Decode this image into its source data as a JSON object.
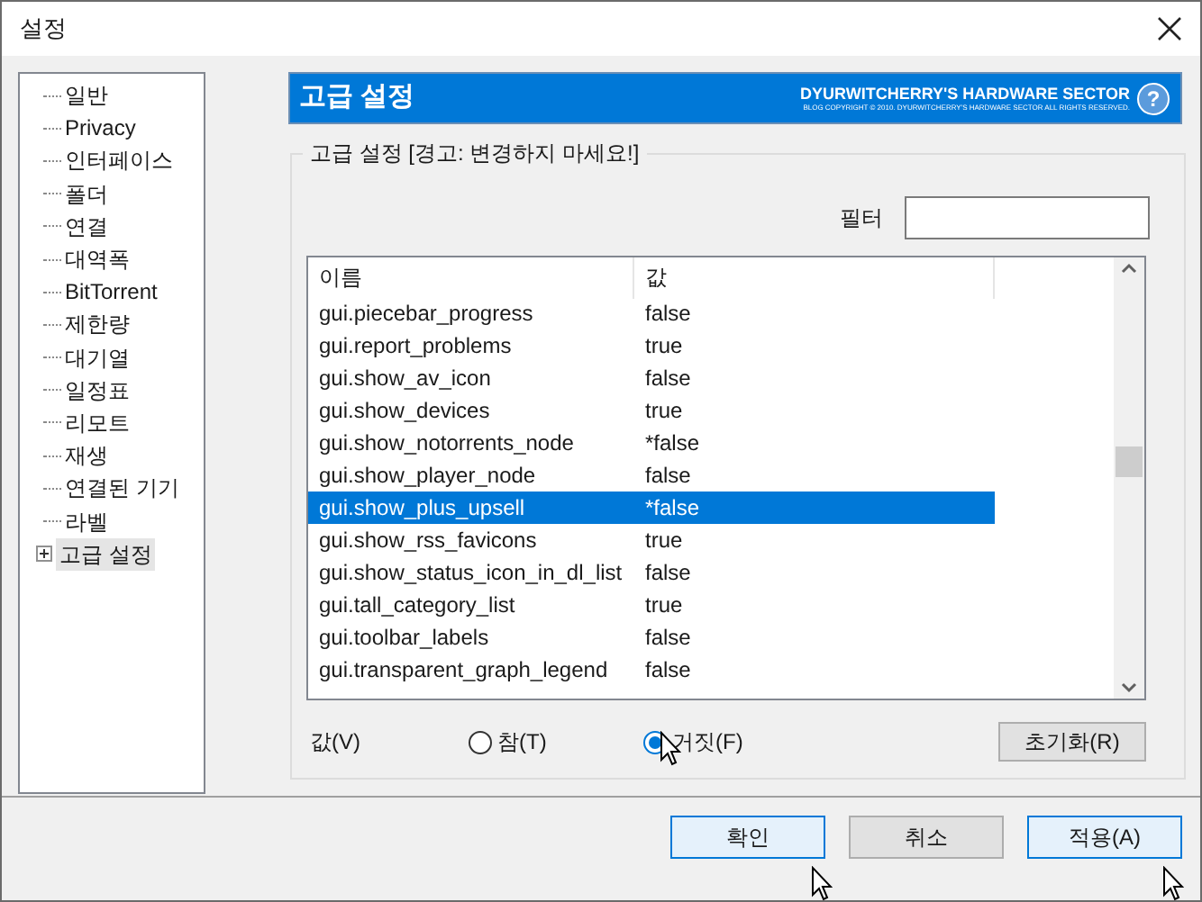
{
  "window": {
    "title": "설정"
  },
  "sidebar": {
    "items": [
      {
        "label": "일반",
        "selected": false
      },
      {
        "label": "Privacy",
        "selected": false
      },
      {
        "label": "인터페이스",
        "selected": false
      },
      {
        "label": "폴더",
        "selected": false
      },
      {
        "label": "연결",
        "selected": false
      },
      {
        "label": "대역폭",
        "selected": false
      },
      {
        "label": "BitTorrent",
        "selected": false
      },
      {
        "label": "제한량",
        "selected": false
      },
      {
        "label": "대기열",
        "selected": false
      },
      {
        "label": "일정표",
        "selected": false
      },
      {
        "label": "리모트",
        "selected": false
      },
      {
        "label": "재생",
        "selected": false
      },
      {
        "label": "연결된 기기",
        "selected": false
      },
      {
        "label": "라벨",
        "selected": false
      },
      {
        "label": "고급 설정",
        "selected": true,
        "expandable": true
      }
    ]
  },
  "banner": {
    "title": "고급 설정",
    "brand": "DYURWITCHERRY'S HARDWARE SECTOR",
    "copyright": "BLOG COPYRIGHT © 2010. DYURWITCHERRY'S HARDWARE SECTOR ALL RIGHTS RESERVED.",
    "help": "?"
  },
  "group": {
    "title": "고급 설정 [경고: 변경하지 마세요!]",
    "filter": {
      "label": "필터"
    },
    "table": {
      "columns": [
        "이름",
        "값"
      ],
      "rows": [
        {
          "name": "gui.piecebar_progress",
          "value": "false",
          "selected": false
        },
        {
          "name": "gui.report_problems",
          "value": "true",
          "selected": false
        },
        {
          "name": "gui.show_av_icon",
          "value": "false",
          "selected": false
        },
        {
          "name": "gui.show_devices",
          "value": "true",
          "selected": false
        },
        {
          "name": "gui.show_notorrents_node",
          "value": "*false",
          "selected": false
        },
        {
          "name": "gui.show_player_node",
          "value": "false",
          "selected": false
        },
        {
          "name": "gui.show_plus_upsell",
          "value": "*false",
          "selected": true
        },
        {
          "name": "gui.show_rss_favicons",
          "value": "true",
          "selected": false
        },
        {
          "name": "gui.show_status_icon_in_dl_list",
          "value": "false",
          "selected": false
        },
        {
          "name": "gui.tall_category_list",
          "value": "true",
          "selected": false
        },
        {
          "name": "gui.toolbar_labels",
          "value": "false",
          "selected": false
        },
        {
          "name": "gui.transparent_graph_legend",
          "value": "false",
          "selected": false
        }
      ]
    },
    "value_label": "값(V)",
    "options": [
      {
        "label": "참(T)",
        "selected": false
      },
      {
        "label": "거짓(F)",
        "selected": true
      }
    ],
    "reset": "초기화(R)"
  },
  "buttons": [
    {
      "label": "확인",
      "focused": true
    },
    {
      "label": "취소",
      "focused": false
    },
    {
      "label": "적용(A)",
      "focused": true
    }
  ]
}
